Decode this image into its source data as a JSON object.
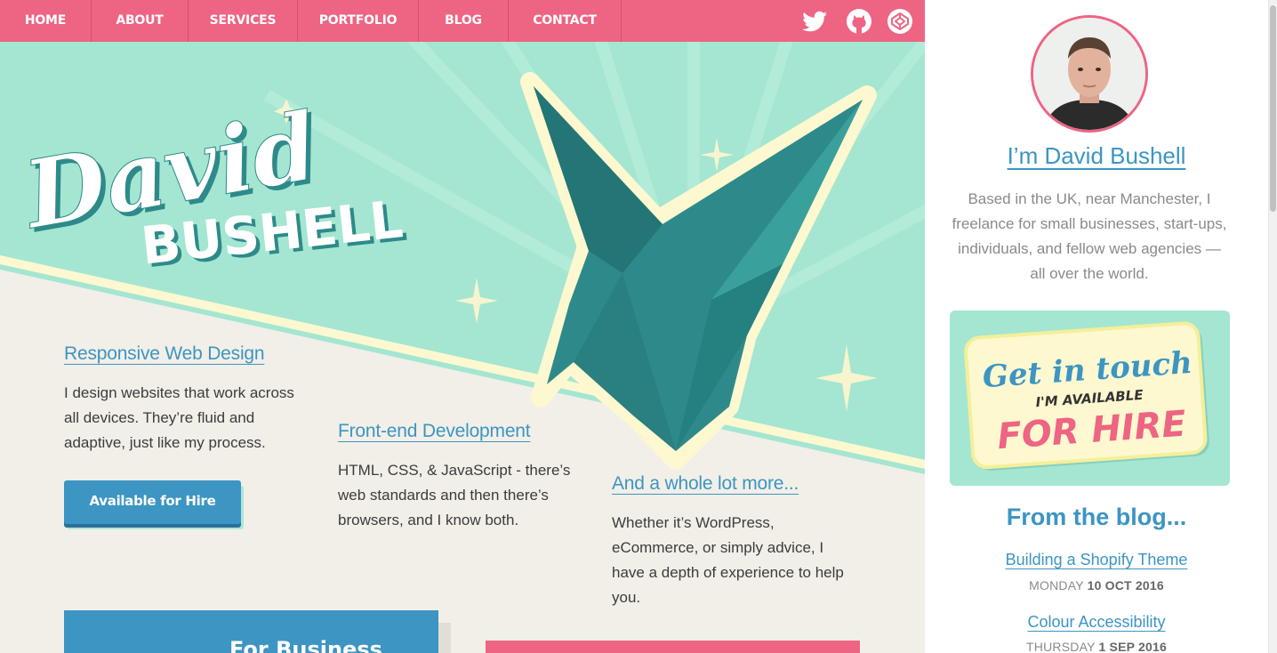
{
  "nav": {
    "items": [
      "HOME",
      "ABOUT",
      "SERVICES",
      "PORTFOLIO",
      "BLOG",
      "CONTACT"
    ],
    "social_icons": [
      "twitter-icon",
      "github-icon",
      "codepen-icon"
    ]
  },
  "hero": {
    "logo_line1": "David",
    "logo_line2": "BUSHELL"
  },
  "services": [
    {
      "title": "Responsive Web Design",
      "lines": [
        "I design websites that work across",
        "all devices. They’re fluid and",
        "adaptive, just like my process."
      ]
    },
    {
      "title": "Front-end Development",
      "lines": [
        "HTML, CSS, & JavaScript - there’s",
        "web standards and then there’s",
        "browsers, and I know both."
      ]
    },
    {
      "title": "And a whole lot more...",
      "lines": [
        "Whether it’s WordPress,",
        "eCommerce, or simply advice, I",
        "have a depth of experience to help",
        "you."
      ]
    }
  ],
  "hire_button": "Available for Hire",
  "card_blue_text": "For Business",
  "sidebar": {
    "title": "I’m David Bushell",
    "about_lines": [
      "Based in the UK, near Manchester, I",
      "freelance for small businesses, start-ups,",
      "individuals, and fellow web agencies —",
      "all over the world."
    ],
    "hire_card": {
      "line1": "Get in touch",
      "line2": "I'M AVAILABLE",
      "line3": "FOR HIRE"
    },
    "blog_title": "From the blog...",
    "posts": [
      {
        "title": "Building a Shopify Theme",
        "day": "MONDAY",
        "date": "10 OCT 2016"
      },
      {
        "title": "Colour Accessibility",
        "day": "THURSDAY",
        "date": "1 SEP 2016"
      }
    ]
  },
  "colors": {
    "nav_pink": "#ee6483",
    "mint": "#a4e6d1",
    "blue": "#3c95c3",
    "cream": "#f2efe8",
    "crane": "#2e8a8a"
  }
}
